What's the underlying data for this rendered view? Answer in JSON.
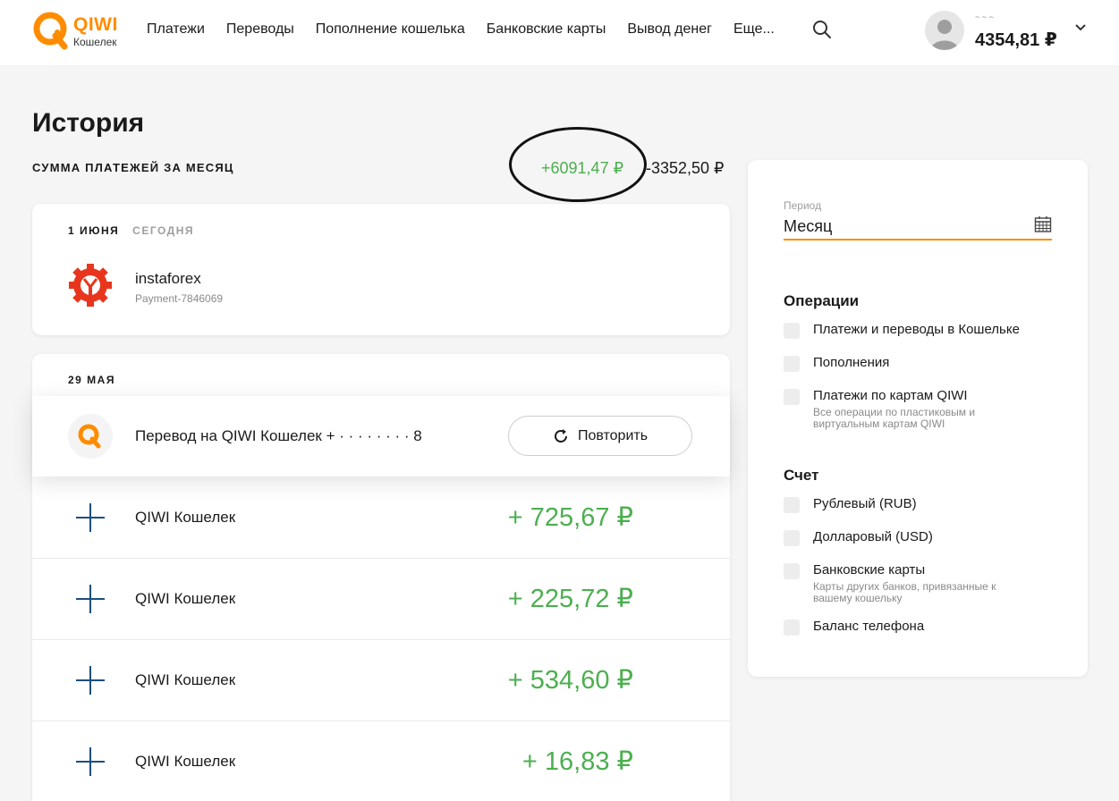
{
  "header": {
    "logo_brand": "QIWI",
    "logo_sub": "Кошелек",
    "nav": [
      "Платежи",
      "Переводы",
      "Пополнение кошелька",
      "Банковские карты",
      "Вывод денег",
      "Еще..."
    ],
    "user_name": "~ ~ ~",
    "balance": "4354,81 ₽"
  },
  "history": {
    "title": "История",
    "sum_label": "СУММА ПЛАТЕЖЕЙ ЗА МЕСЯЦ",
    "sum_in": "+6091,47 ₽",
    "sum_out": "-3352,50 ₽"
  },
  "groups": [
    {
      "date": "1 ИЮНЯ",
      "date_sub": "СЕГОДНЯ",
      "items": [
        {
          "title": "instaforex",
          "subtitle": "Payment-7846069"
        }
      ]
    },
    {
      "date": "29 МАЯ",
      "items": [
        {
          "title": "Перевод на QIWI Кошелек +  ·  · · ·  ·   ·  ·   ·  8",
          "button": "Повторить"
        },
        {
          "title": "QIWI Кошелек",
          "amount": "+ 725,67 ₽"
        },
        {
          "title": "QIWI Кошелек",
          "amount": "+ 225,72 ₽"
        },
        {
          "title": "QIWI Кошелек",
          "amount": "+ 534,60 ₽"
        },
        {
          "title": "QIWI Кошелек",
          "amount": "+ 16,83 ₽"
        }
      ]
    }
  ],
  "filters": {
    "period_label": "Период",
    "period_value": "Месяц",
    "operations_title": "Операции",
    "operations": [
      {
        "label": "Платежи и переводы в Кошельке"
      },
      {
        "label": "Пополнения"
      },
      {
        "label": "Платежи по картам QIWI",
        "note": "Все операции по пластиковым и виртуальным картам QIWI"
      }
    ],
    "account_title": "Счет",
    "accounts": [
      {
        "label": "Рублевый (RUB)"
      },
      {
        "label": "Долларовый (USD)"
      },
      {
        "label": "Банковские карты",
        "note": "Карты других банков, привязанные к вашему кошельку"
      },
      {
        "label": "Баланс телефона"
      }
    ]
  },
  "colors": {
    "accent": "#ff8c00",
    "income": "#4caf50",
    "plus_icon": "#1c4e80"
  }
}
